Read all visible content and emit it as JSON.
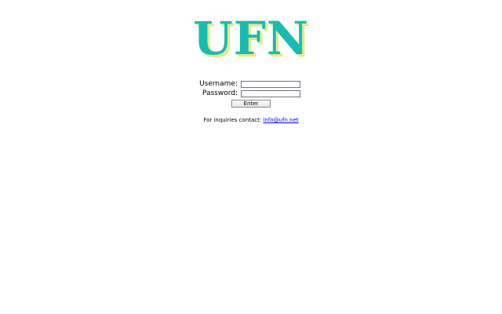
{
  "header": {
    "logo_text": "UFN"
  },
  "login": {
    "username_label": "Username:",
    "username_value": "",
    "password_label": "Password:",
    "password_value": "",
    "enter_label": "Enter"
  },
  "footer": {
    "contact_prefix": "For inquiries contact:",
    "contact_email": "info@ufn.net"
  },
  "colors": {
    "logo": "#17bcb0",
    "logo_shadow": "#f2ec8a",
    "link": "#0000ee"
  }
}
